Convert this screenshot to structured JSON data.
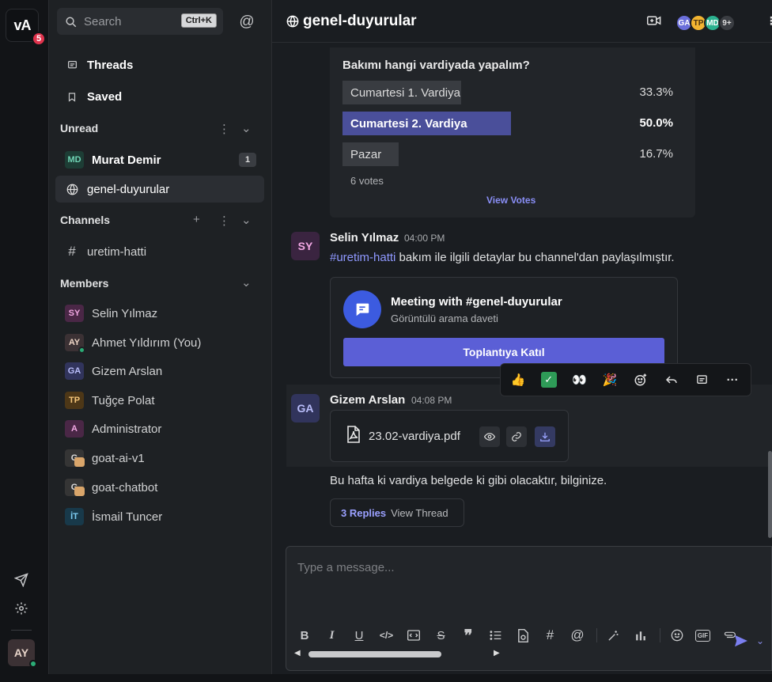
{
  "workspace": {
    "initials": "vA",
    "badge": "5"
  },
  "rail": {
    "icons": [
      "send-icon",
      "gear-icon"
    ],
    "user_initials": "AY"
  },
  "sidebar": {
    "search_placeholder": "Search",
    "search_shortcut": "Ctrl+K",
    "threads_label": "Threads",
    "saved_label": "Saved",
    "unread_header": "Unread",
    "unread": [
      {
        "initials": "MD",
        "name": "Murat Demir",
        "count": "1"
      },
      {
        "name": "genel-duyurular"
      }
    ],
    "channels_header": "Channels",
    "channels": [
      {
        "name": "uretim-hatti"
      }
    ],
    "members_header": "Members",
    "members": [
      {
        "initials": "SY",
        "name": "Selin Yılmaz",
        "bg": "#4a2746",
        "fg": "#f2a8e4"
      },
      {
        "initials": "AY",
        "name": "Ahmet Yıldırım (You)",
        "bg": "#3b3134",
        "fg": "#f0d6c6"
      },
      {
        "initials": "GA",
        "name": "Gizem Arslan",
        "bg": "#31345c",
        "fg": "#b9bdfa"
      },
      {
        "initials": "TP",
        "name": "Tuğçe Polat",
        "bg": "#4d3717",
        "fg": "#f5c67a"
      },
      {
        "initials": "A",
        "name": "Administrator",
        "bg": "#4a2746",
        "fg": "#f2a8e4"
      },
      {
        "initials": "G",
        "name": "goat-ai-v1",
        "bg": "#353535",
        "fg": "#dddddd"
      },
      {
        "initials": "G",
        "name": "goat-chatbot",
        "bg": "#353535",
        "fg": "#dddddd"
      },
      {
        "initials": "İT",
        "name": "İsmail Tuncer",
        "bg": "#18394a",
        "fg": "#7fcff5"
      }
    ]
  },
  "channel": {
    "title": "genel-duyurular",
    "avatars": [
      {
        "initials": "GA",
        "bg": "#6b6fdb",
        "fg": "#ffffff"
      },
      {
        "initials": "TP",
        "bg": "#f2b431",
        "fg": "#4a3210"
      },
      {
        "initials": "MD",
        "bg": "#2bb18f",
        "fg": "#ffffff"
      },
      {
        "initials": "9+",
        "bg": "#3a3d42",
        "fg": "#dddddd"
      }
    ]
  },
  "poll": {
    "question": "Bakımı hangi vardiyada yapalım?",
    "options": [
      {
        "label": "Cumartesi 1. Vardiya",
        "percent": "33.3%",
        "share": 0.333
      },
      {
        "label": "Cumartesi 2. Vardiya",
        "percent": "50.0%",
        "share": 0.5
      },
      {
        "label": "Pazar",
        "percent": "16.7%",
        "share": 0.167
      }
    ],
    "votes": "6 votes",
    "view_votes": "View Votes"
  },
  "messages": [
    {
      "initials": "SY",
      "name": "Selin Yılmaz",
      "time": "04:00 PM",
      "mention": "#uretim-hatti",
      "text": " bakım ile ilgili detaylar bu channel'dan paylaşılmıştır.",
      "meeting": {
        "title": "Meeting with #genel-duyurular",
        "subtitle": "Görüntülü arama daveti",
        "button": "Toplantıya Katıl"
      }
    },
    {
      "initials": "GA",
      "name": "Gizem Arslan",
      "time": "04:08 PM",
      "file": "23.02-vardiya.pdf",
      "text": "Bu hafta ki vardiya belgede ki gibi olacaktır, bilginize.",
      "replies_count": "3 Replies",
      "view_thread": "View Thread"
    }
  ],
  "reaction_bar": [
    "thumbs-up-icon",
    "check-icon",
    "eyes-icon",
    "party-icon",
    "add-reaction-icon",
    "reply-icon",
    "thread-icon",
    "more-icon"
  ],
  "composer": {
    "placeholder": "Type a message..."
  }
}
